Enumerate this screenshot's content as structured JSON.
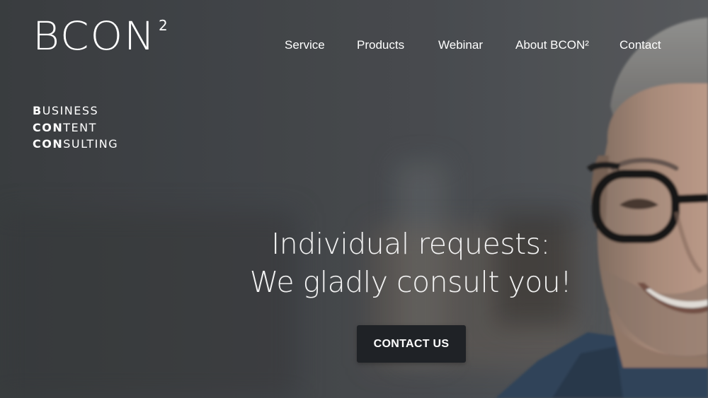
{
  "brand": {
    "logo_text": "BCON",
    "logo_superscript": "2",
    "tagline": [
      {
        "bold": "B",
        "rest": "USINESS"
      },
      {
        "bold": "CON",
        "rest": "TENT"
      },
      {
        "bold": "CON",
        "rest": "SULTING"
      }
    ]
  },
  "nav": {
    "items": [
      {
        "label": "Service"
      },
      {
        "label": "Products"
      },
      {
        "label": "Webinar"
      },
      {
        "label": "About BCON²"
      },
      {
        "label": "Contact"
      }
    ]
  },
  "hero": {
    "headline_line1": "Individual requests:",
    "headline_line2": "We gladly consult you!",
    "cta_label": "CONTACT US"
  },
  "colors": {
    "background": "#45484c",
    "text": "#ffffff",
    "cta_background": "#1f2226"
  }
}
